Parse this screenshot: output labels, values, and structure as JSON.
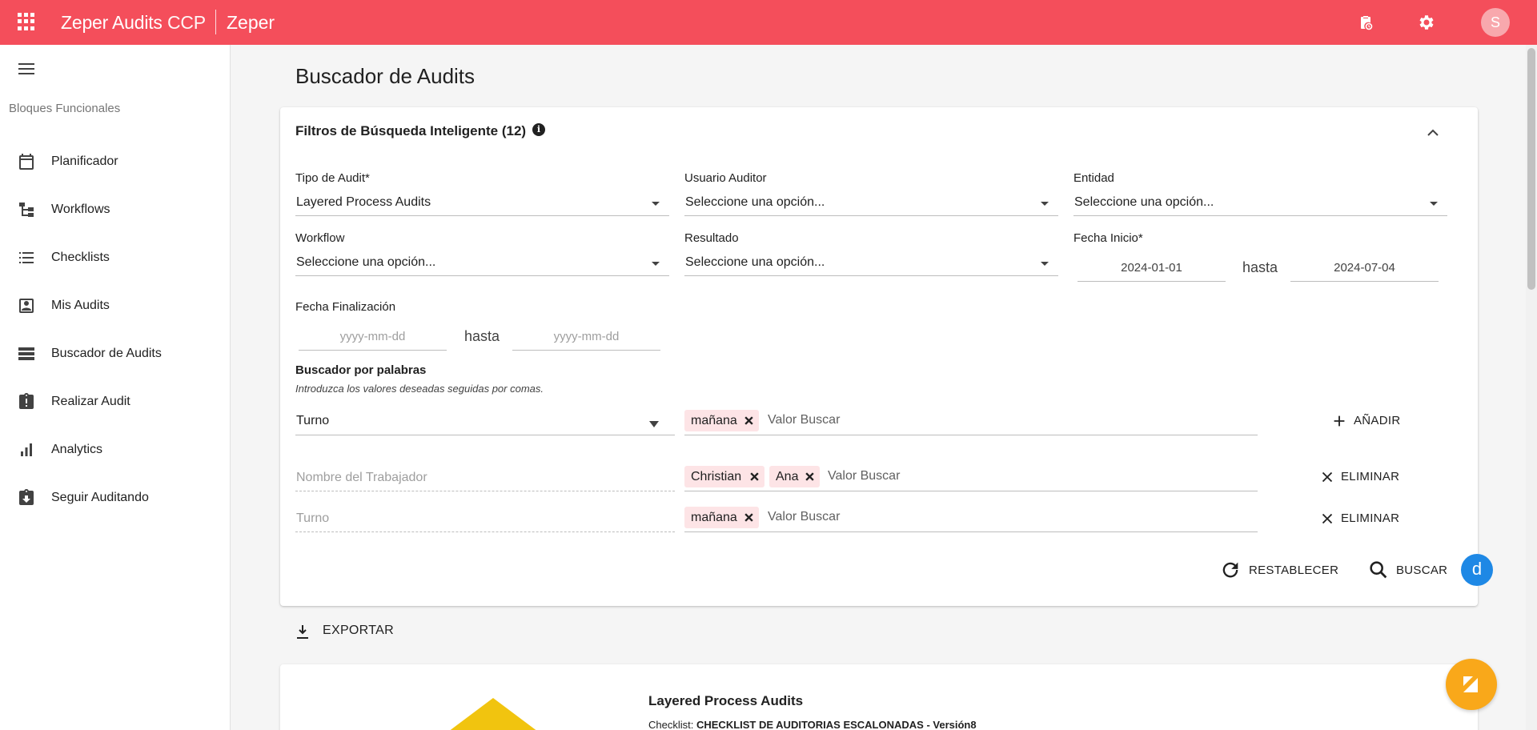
{
  "header": {
    "brand_strong": "Zeper Audits",
    "brand_light": "CCP",
    "org": "Zeper",
    "avatar_letter": "S",
    "color": "#f44e5b"
  },
  "sidebar": {
    "section": "Bloques Funcionales",
    "items": [
      {
        "label": "Planificador",
        "icon": "calendar-icon"
      },
      {
        "label": "Workflows",
        "icon": "workflow-icon"
      },
      {
        "label": "Checklists",
        "icon": "checklist-icon"
      },
      {
        "label": "Mis Audits",
        "icon": "user-box-icon"
      },
      {
        "label": "Buscador de Audits",
        "icon": "storage-icon"
      },
      {
        "label": "Realizar Audit",
        "icon": "clipboard-alert-icon"
      },
      {
        "label": "Analytics",
        "icon": "bar-chart-icon"
      },
      {
        "label": "Seguir Auditando",
        "icon": "clipboard-download-icon"
      }
    ]
  },
  "page": {
    "title": "Buscador de Audits"
  },
  "filters": {
    "title": "Filtros de Búsqueda Inteligente (12)",
    "tipo_audit": {
      "label": "Tipo de Audit*",
      "value": "Layered Process Audits"
    },
    "usuario_auditor": {
      "label": "Usuario Auditor",
      "value": "Seleccione una opción..."
    },
    "entidad": {
      "label": "Entidad",
      "value": "Seleccione una opción..."
    },
    "workflow": {
      "label": "Workflow",
      "value": "Seleccione una opción..."
    },
    "resultado": {
      "label": "Resultado",
      "value": "Seleccione una opción..."
    },
    "fecha_inicio": {
      "label": "Fecha Inicio*",
      "from": "2024-01-01",
      "to": "2024-07-04",
      "sep": "hasta"
    },
    "fecha_fin": {
      "label": "Fecha Finalización",
      "from_ph": "yyyy-mm-dd",
      "to_ph": "yyyy-mm-dd",
      "sep": "hasta"
    },
    "keywords": {
      "label": "Buscador por palabras",
      "hint": "Introduzca los valores deseadas seguidas por comas.",
      "value_placeholder": "Valor Buscar",
      "rows": [
        {
          "field": "Turno",
          "chips": [
            "mañana"
          ],
          "action": "AÑADIR"
        },
        {
          "field": "Nombre del Trabajador",
          "chips": [
            "Christian",
            "Ana"
          ],
          "action": "ELIMINAR"
        },
        {
          "field": "Turno",
          "chips": [
            "mañana"
          ],
          "action": "ELIMINAR"
        }
      ]
    },
    "reset_label": "RESTABLECER",
    "search_label": "BUSCAR",
    "fab_letter": "d"
  },
  "export_label": "EXPORTAR",
  "result": {
    "title": "Layered Process Audits",
    "checklist_prefix": "Checklist:",
    "checklist_value": "CHECKLIST DE AUDITORIAS ESCALONADAS - Versión8"
  }
}
